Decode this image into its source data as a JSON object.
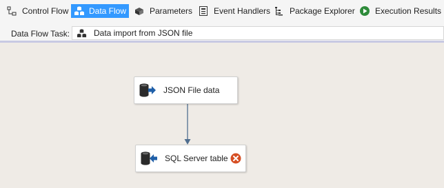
{
  "tabs": [
    {
      "label": "Control Flow",
      "icon": "control-flow-icon",
      "active": false
    },
    {
      "label": "Data Flow",
      "icon": "data-flow-icon",
      "active": true
    },
    {
      "label": "Parameters",
      "icon": "parameters-icon",
      "active": false
    },
    {
      "label": "Event Handlers",
      "icon": "event-handlers-icon",
      "active": false
    },
    {
      "label": "Package Explorer",
      "icon": "package-explorer-icon",
      "active": false
    },
    {
      "label": "Execution Results",
      "icon": "execution-results-icon",
      "active": false
    }
  ],
  "task": {
    "label": "Data Flow Task:",
    "selected": "Data import from JSON file",
    "icon": "data-flow-task-icon"
  },
  "canvas": {
    "source": {
      "label": "JSON File data",
      "icon": "source-icon"
    },
    "destination": {
      "label": "SQL Server table",
      "icon": "destination-icon",
      "status_icon": "error-icon"
    }
  },
  "colors": {
    "active_tab": "#3399ff",
    "canvas": "#efebe6",
    "connector": "#4f6e8f",
    "error": "#d64f24"
  }
}
